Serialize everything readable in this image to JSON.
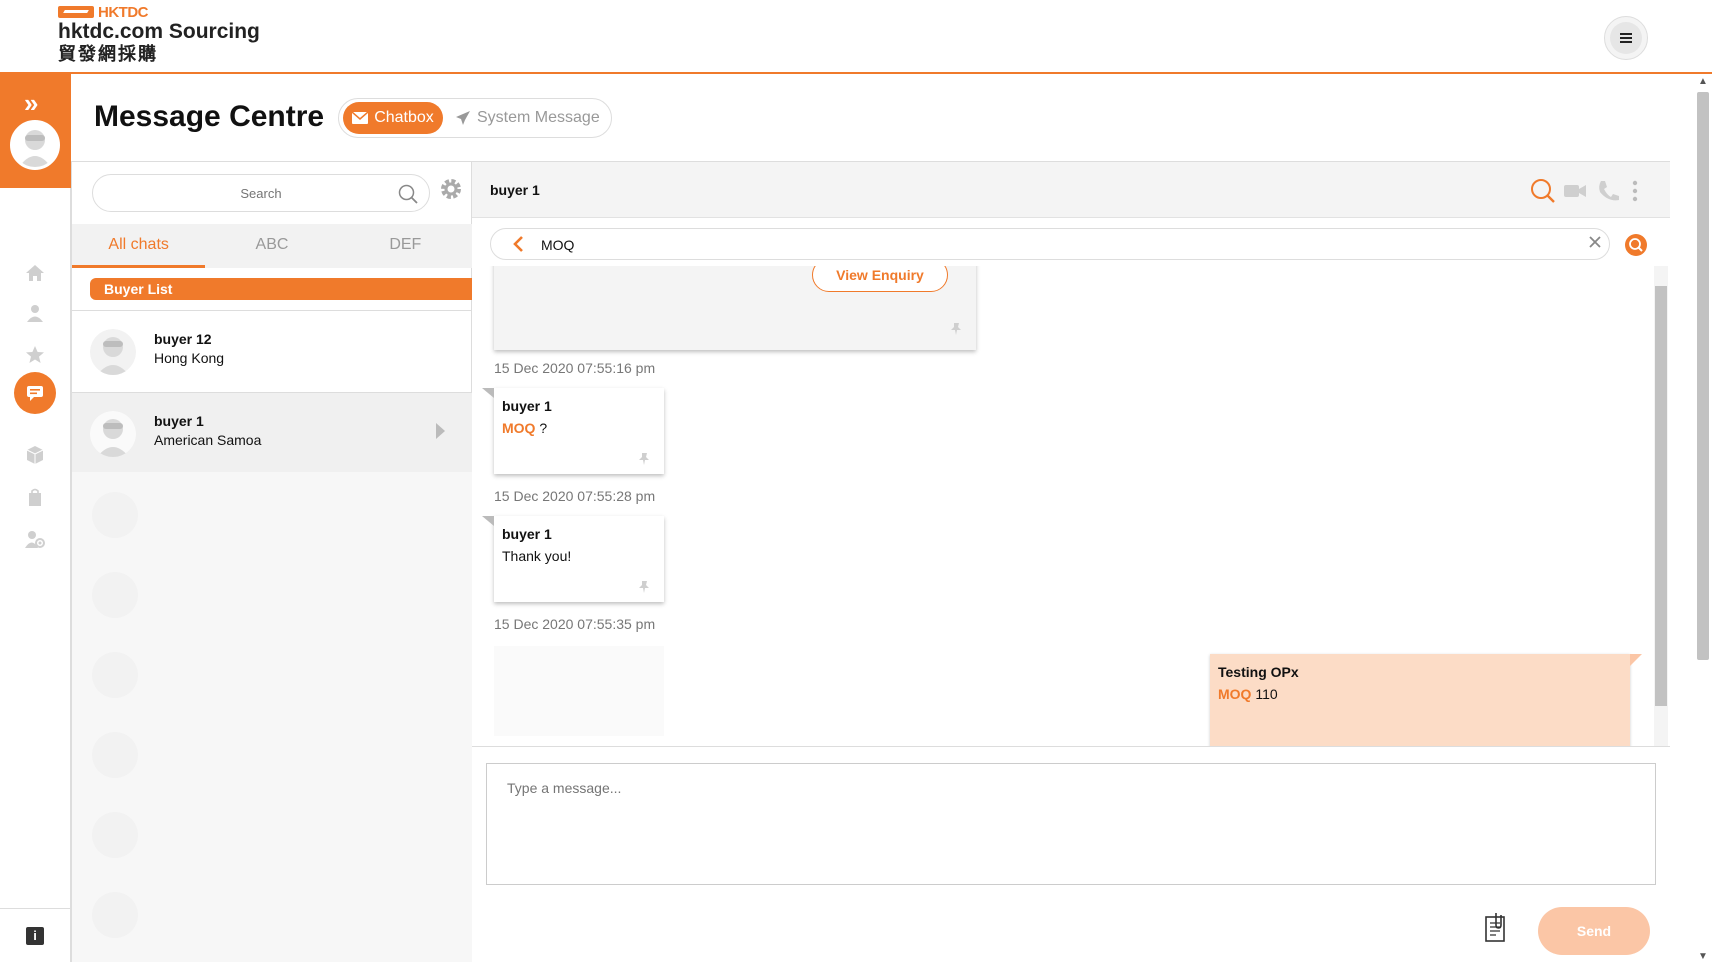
{
  "header": {
    "logo_brand": "HKTDC",
    "logo_line1": "hktdc.com Sourcing",
    "logo_line2": "貿發網採購",
    "menu_icon": "hamburger-icon"
  },
  "sidebar": {
    "expand_icon": "double-chevron-right-icon",
    "items": [
      {
        "icon": "home-icon"
      },
      {
        "icon": "user-icon"
      },
      {
        "icon": "star-icon"
      },
      {
        "icon": "chat-icon",
        "active": true
      },
      {
        "icon": "box-icon"
      },
      {
        "icon": "bag-icon"
      },
      {
        "icon": "user-settings-icon"
      }
    ],
    "info_label": "i"
  },
  "page": {
    "title": "Message Centre",
    "tabs": [
      {
        "label": "Chatbox",
        "active": true
      },
      {
        "label": "System Message",
        "active": false
      }
    ]
  },
  "chat_list": {
    "search_placeholder": "Search",
    "filters": [
      {
        "label": "All chats",
        "active": true
      },
      {
        "label": "ABC",
        "active": false
      },
      {
        "label": "DEF",
        "active": false
      }
    ],
    "section_label": "Buyer List",
    "buyers": [
      {
        "name": "buyer 12",
        "location": "Hong Kong",
        "selected": false
      },
      {
        "name": "buyer 1",
        "location": "American Samoa",
        "selected": true
      }
    ]
  },
  "conversation": {
    "title": "buyer 1",
    "search_value": "MOQ",
    "enquiry_button": "View Enquiry",
    "messages": [
      {
        "timestamp": "15 Dec 2020 07:55:16 pm"
      },
      {
        "sender": "buyer 1",
        "highlight": "MOQ",
        "text": " ?",
        "timestamp": "15 Dec 2020 07:55:28 pm"
      },
      {
        "sender": "buyer 1",
        "highlight": "",
        "text": "Thank you!",
        "timestamp": "15 Dec 2020 07:55:35 pm"
      },
      {
        "sender": "Testing OPx",
        "highlight": "MOQ",
        "text": " 110",
        "own": true
      }
    ],
    "composer_placeholder": "Type a message...",
    "send_label": "Send"
  },
  "colors": {
    "accent": "#f07a2b",
    "accent_light": "#fbc6a6",
    "own_bubble": "#fcdcc6"
  }
}
